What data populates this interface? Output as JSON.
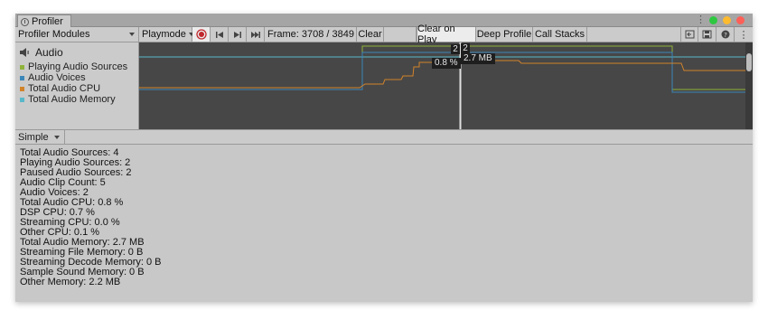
{
  "window": {
    "tab_title": "Profiler",
    "tab_icon": "profiler-icon",
    "traffic_lights": {
      "green": "#2dc840",
      "yellow": "#febb2e",
      "red": "#fe5f57"
    }
  },
  "toolbar": {
    "modules_label": "Profiler Modules",
    "mode_label": "Playmode",
    "frame_text": "Frame: 3708 / 3849",
    "clear_label": "Clear",
    "clear_on_play_label": "Clear on Play",
    "deep_profile_label": "Deep Profile",
    "call_stacks_label": "Call Stacks",
    "icons": [
      "record-icon",
      "first-frame-icon",
      "next-frame-icon",
      "last-frame-icon",
      "load-icon",
      "save-icon",
      "help-icon",
      "more-icon"
    ]
  },
  "module": {
    "name": "Audio",
    "icon": "speaker-icon",
    "legend": [
      {
        "label": "Playing Audio Sources",
        "color": "#8fb33a"
      },
      {
        "label": "Audio Voices",
        "color": "#3b86b8"
      },
      {
        "label": "Total Audio CPU",
        "color": "#d2832a"
      },
      {
        "label": "Total Audio Memory",
        "color": "#58b8c8"
      }
    ]
  },
  "graph": {
    "tooltips": {
      "playing": "2",
      "voices": "2",
      "cpu": "0.8 %",
      "memory": "2.7 MB"
    }
  },
  "detail": {
    "view_mode": "Simple",
    "stats": [
      "Total Audio Sources: 4",
      "Playing Audio Sources: 2",
      "Paused Audio Sources: 2",
      "Audio Clip Count: 5",
      "Audio Voices: 2",
      "Total Audio CPU: 0.8 %",
      "DSP CPU: 0.7 %",
      "Streaming CPU: 0.0 %",
      "Other CPU: 0.1 %",
      "Total Audio Memory: 2.7 MB",
      "Streaming File Memory: 0 B",
      "Streaming Decode Memory: 0 B",
      "Sample Sound Memory: 0 B",
      "Other Memory: 2.2 MB"
    ]
  }
}
